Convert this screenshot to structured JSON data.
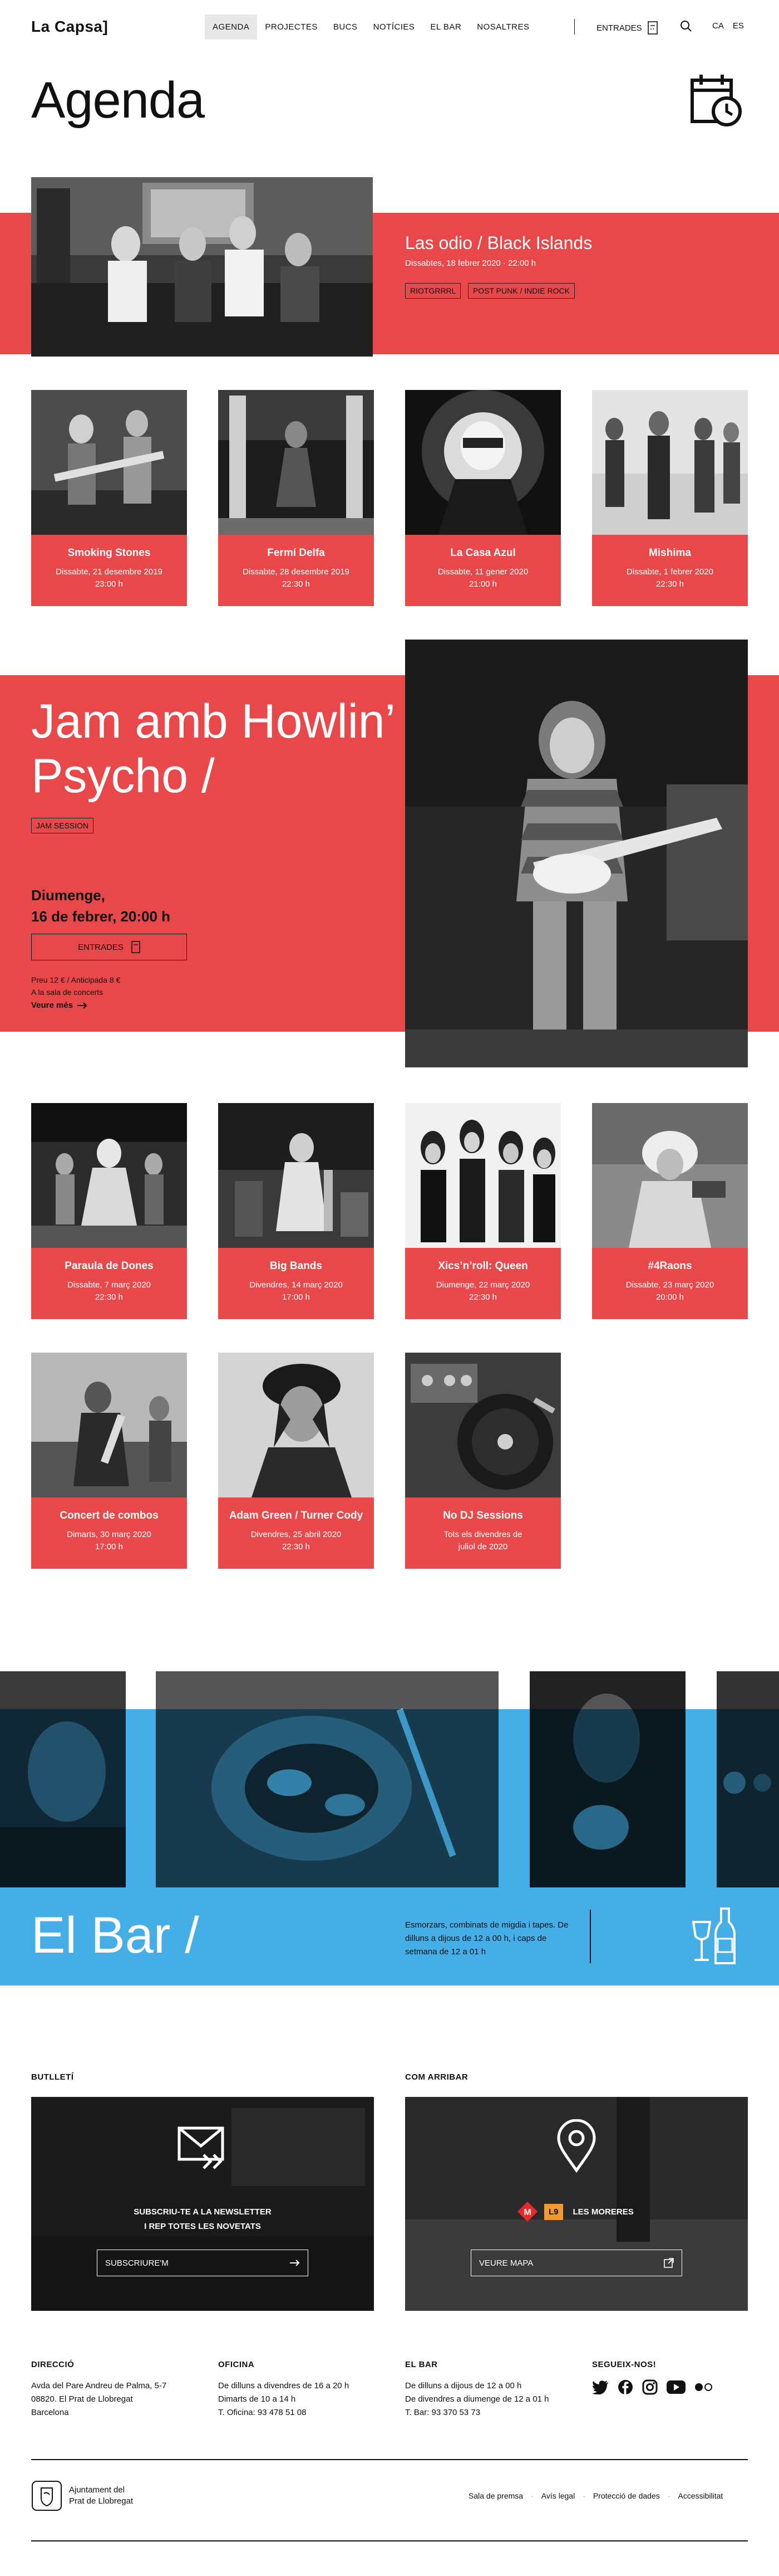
{
  "header": {
    "logo": "La Capsa]",
    "nav": [
      "AGENDA",
      "PROJECTES",
      "BUCS",
      "NOTÍCIES",
      "EL BAR",
      "NOSALTRES"
    ],
    "entrades": "ENTRADES",
    "lang": [
      "CA",
      "ES"
    ]
  },
  "page_title": "Agenda",
  "featured": {
    "title": "Las odio / Black Islands",
    "date": "Dissabtes, 18 febrer 2020 · 22:00 h",
    "tags": [
      "RIOTGRRRL",
      "POST PUNK / INDIE ROCK"
    ]
  },
  "events_row1": [
    {
      "title": "Smoking Stones",
      "date": "Dissabte, 21 desembre 2019",
      "time": "23:00 h"
    },
    {
      "title": "Fermí Delfa",
      "date": "Dissabte, 28 desembre 2019",
      "time": "22:30 h"
    },
    {
      "title": "La Casa Azul",
      "date": "Dissabte, 11 gener 2020",
      "time": "21:00 h"
    },
    {
      "title": "Mishima",
      "date": "Dissabte, 1 febrer 2020",
      "time": "22:30 h"
    }
  ],
  "big": {
    "title": "Jam amb Howlin’ Psycho /",
    "tag": "JAM SESSION",
    "date_line1": "Diumenge,",
    "date_line2": "16 de febrer, 20:00 h",
    "button": "ENTRADES",
    "price": "Preu 12 € / Anticipada 8 €",
    "place": "A la sala de concerts",
    "more": "Veure més"
  },
  "events_row2": [
    {
      "title": "Paraula de Dones",
      "date": "Dissabte, 7 març 2020",
      "time": "22:30 h"
    },
    {
      "title": "Big Bands",
      "date": "Divendres, 14 març 2020",
      "time": "17:00 h"
    },
    {
      "title": "Xics’n’roll: Queen",
      "date": "Diumenge, 22 març 2020",
      "time": "22:30 h"
    },
    {
      "title": "#4Raons",
      "date": "Dissabte, 23 març 2020",
      "time": "20:00 h"
    }
  ],
  "events_row3": [
    {
      "title": "Concert de combos",
      "date": "Dimarts, 30 març 2020",
      "time": "17:00 h"
    },
    {
      "title": "Adam Green / Turner Cody",
      "date": "Divendres, 25 abril 2020",
      "time": "22:30 h"
    },
    {
      "title": "No DJ Sessions",
      "date": "Tots els divendres de",
      "time": "juliol de 2020"
    }
  ],
  "bar": {
    "title": "El Bar /",
    "text": "Esmorzars, combinats de migdia i tapes. De dilluns a dijous de 12 a 00 h, i caps de setmana de 12 a 01 h"
  },
  "newsletter": {
    "label": "BUTLLETÍ",
    "line1": "SUBSCRIU-TE A LA NEWSLETTER",
    "line2": "I REP TOTES LES NOVETATS",
    "button": "SUBSCRIURE'M"
  },
  "arrive": {
    "label": "COM ARRIBAR",
    "metro_line": "L9",
    "stop": "LES MORERES",
    "button": "VEURE MAPA"
  },
  "footer": {
    "direccio": {
      "head": "DIRECCIÓ",
      "lines": [
        "Avda del Pare Andreu de Palma, 5-7",
        "08820. El Prat de Llobregat",
        "Barcelona"
      ]
    },
    "oficina": {
      "head": "OFICINA",
      "lines": [
        "De dilluns a divendres de 16 a 20 h",
        "Dimarts de 10 a 14 h",
        "T. Oficina: 93 478 51 08"
      ]
    },
    "elbar": {
      "head": "EL BAR",
      "lines": [
        "De dilluns a dijous de 12 a 00 h",
        "De divendres a diumenge de 12 a 01 h",
        "T. Bar: 93 370 53 73"
      ]
    },
    "segueix": {
      "head": "SEGUEIX-NOS!"
    },
    "ajuntament": [
      "Ajuntament del",
      "Prat de Llobregat"
    ],
    "legal": [
      "Sala de premsa",
      "Avís legal",
      "Protecció de dades",
      "Accessibilitat"
    ]
  }
}
